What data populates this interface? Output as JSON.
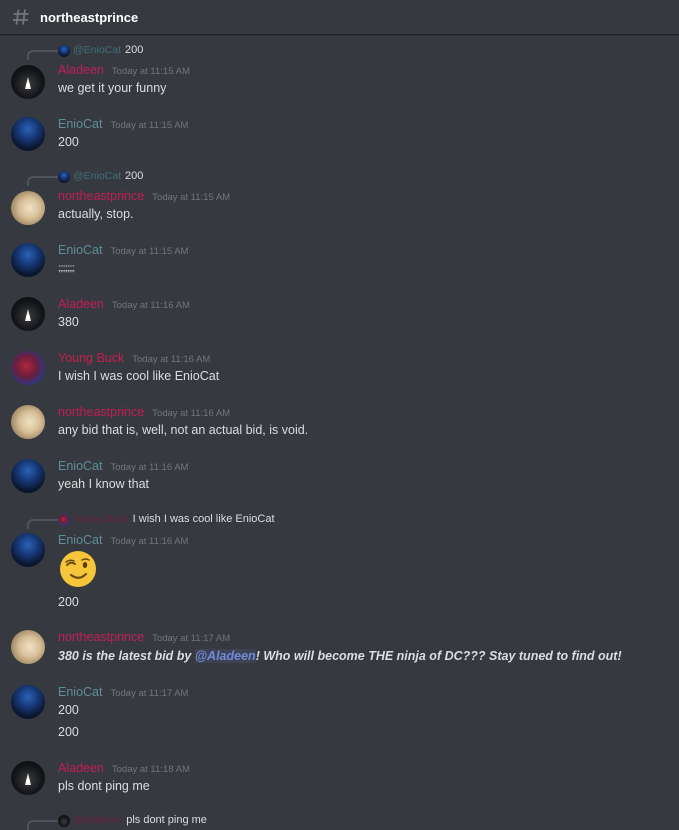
{
  "channel": {
    "name": "northeastprince",
    "icon": "hash-icon"
  },
  "colors": {
    "aladeen": "#c31f55",
    "eniocat": "#5d8f99",
    "northeastprince": "#c31f55",
    "youngbuck": "#c41f4e",
    "mention": "#7289da"
  },
  "messages": [
    {
      "reply": {
        "name": "@EnioCat",
        "text": "200"
      },
      "author": "Aladeen",
      "time": "Today at 11:15 AM",
      "text": "we get it your funny"
    },
    {
      "author": "EnioCat",
      "time": "Today at 11:15 AM",
      "text": "200"
    },
    {
      "reply": {
        "name": "@EnioCat",
        "text": "200"
      },
      "author": "northeastprince",
      "time": "Today at 11:15 AM",
      "text": "actually, stop."
    },
    {
      "author": "EnioCat",
      "time": "Today at 11:15 AM",
      "text": ";;;;;;;;;"
    },
    {
      "author": "Aladeen",
      "time": "Today at 11:16 AM",
      "text": "380"
    },
    {
      "author": "Young Buck",
      "time": "Today at 11:16 AM",
      "text": "I wish I was cool like EnioCat"
    },
    {
      "author": "northeastprince",
      "time": "Today at 11:16 AM",
      "text": "any bid that is, well, not an actual bid, is void."
    },
    {
      "author": "EnioCat",
      "time": "Today at 11:16 AM",
      "text": "yeah I know that"
    },
    {
      "reply": {
        "name": "Young Buck",
        "text": "I wish I was cool like EnioCat"
      },
      "author": "EnioCat",
      "time": "Today at 11:16 AM",
      "emoji": "winking-face-emoji",
      "text": "200"
    },
    {
      "author": "northeastprince",
      "time": "Today at 11:17 AM",
      "text_a": "380 is the latest bid by ",
      "mention": "@Aladeen",
      "text_b": "! Who will become THE ninja of DC??? Stay tuned to find out!"
    },
    {
      "author": "EnioCat",
      "time": "Today at 11:17 AM",
      "text": "200",
      "text2": "200"
    },
    {
      "author": "Aladeen",
      "time": "Today at 11:18 AM",
      "text": "pls dont ping me"
    },
    {
      "reply": {
        "name": "@Aladeen",
        "text": "pls dont ping me"
      }
    }
  ]
}
